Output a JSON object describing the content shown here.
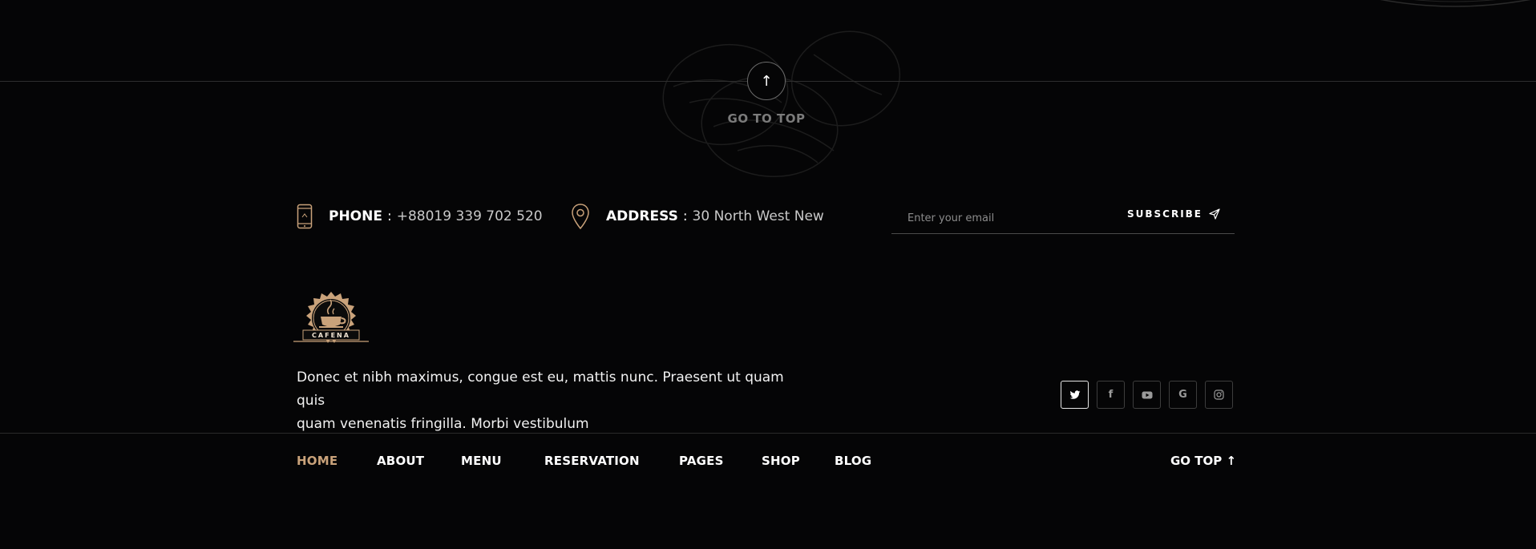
{
  "go_top": {
    "arrow": "↑",
    "label": "GO TO TOP"
  },
  "contact": {
    "phone_label": "PHONE",
    "phone_sep": ":",
    "phone_value": "+88019 339 702 520",
    "address_label": "ADDRESS",
    "address_sep": ":",
    "address_value": "30 North West New"
  },
  "newsletter": {
    "placeholder": "Enter your email",
    "button_label": "SUBSCRIBE"
  },
  "brand": {
    "logo_text": "CAFENA",
    "accent_color": "#c9a27a"
  },
  "description": {
    "line1": "Donec et nibh maximus, congue est eu, mattis nunc. Praesent ut quam quis",
    "line2": "quam venenatis fringilla. Morbi vestibulum"
  },
  "socials": [
    {
      "icon": "twitter-icon"
    },
    {
      "icon": "facebook-icon",
      "glyph": "f"
    },
    {
      "icon": "youtube-icon"
    },
    {
      "icon": "google-icon",
      "glyph": "G"
    },
    {
      "icon": "instagram-icon"
    }
  ],
  "nav": {
    "items": [
      {
        "label": "HOME",
        "active": true
      },
      {
        "label": "ABOUT"
      },
      {
        "label": "MENU"
      },
      {
        "label": "RESERVATION"
      },
      {
        "label": "PAGES"
      },
      {
        "label": "SHOP"
      },
      {
        "label": "BLOG"
      }
    ],
    "go_top_label": "GO TOP ↑"
  }
}
